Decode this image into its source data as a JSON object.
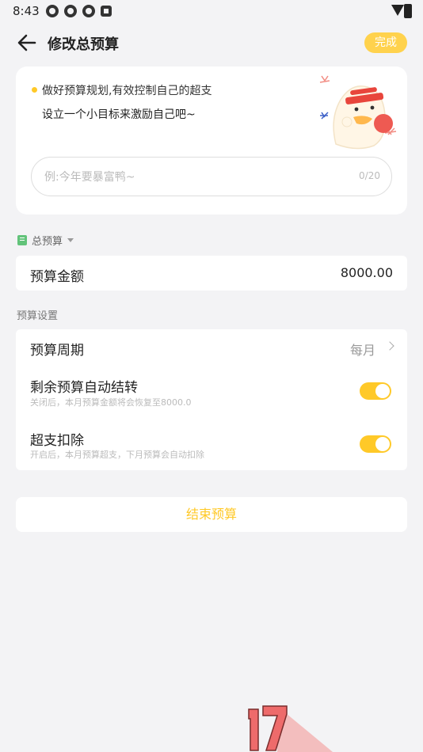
{
  "status_bar": {
    "time": "8:43"
  },
  "header": {
    "title": "修改总预算",
    "done_label": "完成"
  },
  "goal_card": {
    "tip_line1": "做好预算规划,有效控制自己的超支",
    "tip_line2": "设立一个小目标来激励自己吧~",
    "input_placeholder": "例:今年要暴富鸭~",
    "input_value": "",
    "char_counter": "0/20"
  },
  "budget_type": {
    "label": "总预算"
  },
  "amount": {
    "label": "预算金额",
    "value": "8000.00"
  },
  "settings": {
    "header": "预算设置",
    "period": {
      "label": "预算周期",
      "value": "每月"
    },
    "carryover": {
      "label": "剩余预算自动结转",
      "desc": "关闭后，本月预算金额将会恢复至8000.0",
      "enabled": true
    },
    "overspend": {
      "label": "超支扣除",
      "desc": "开启后，本月预算超支，下月预算会自动扣除",
      "enabled": true
    }
  },
  "end_button": {
    "label": "结束预算"
  },
  "colors": {
    "accent": "#ffc928",
    "done_button": "#ffd24d",
    "book_icon": "#62c37a"
  }
}
